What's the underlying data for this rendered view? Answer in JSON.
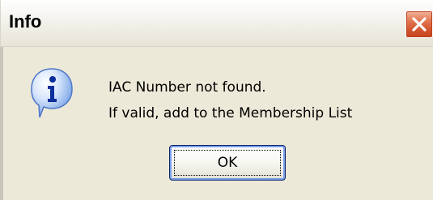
{
  "dialog": {
    "title": "Info",
    "icon": "info-icon",
    "message_lines": [
      "IAC Number not found.",
      "If valid, add to the Membership List"
    ],
    "ok_label": "OK"
  },
  "colors": {
    "title_bar": "#f3f2ec",
    "dialog_background": "#ece9d8",
    "close_button": "#d4552f",
    "button_border": "#0a246a"
  }
}
